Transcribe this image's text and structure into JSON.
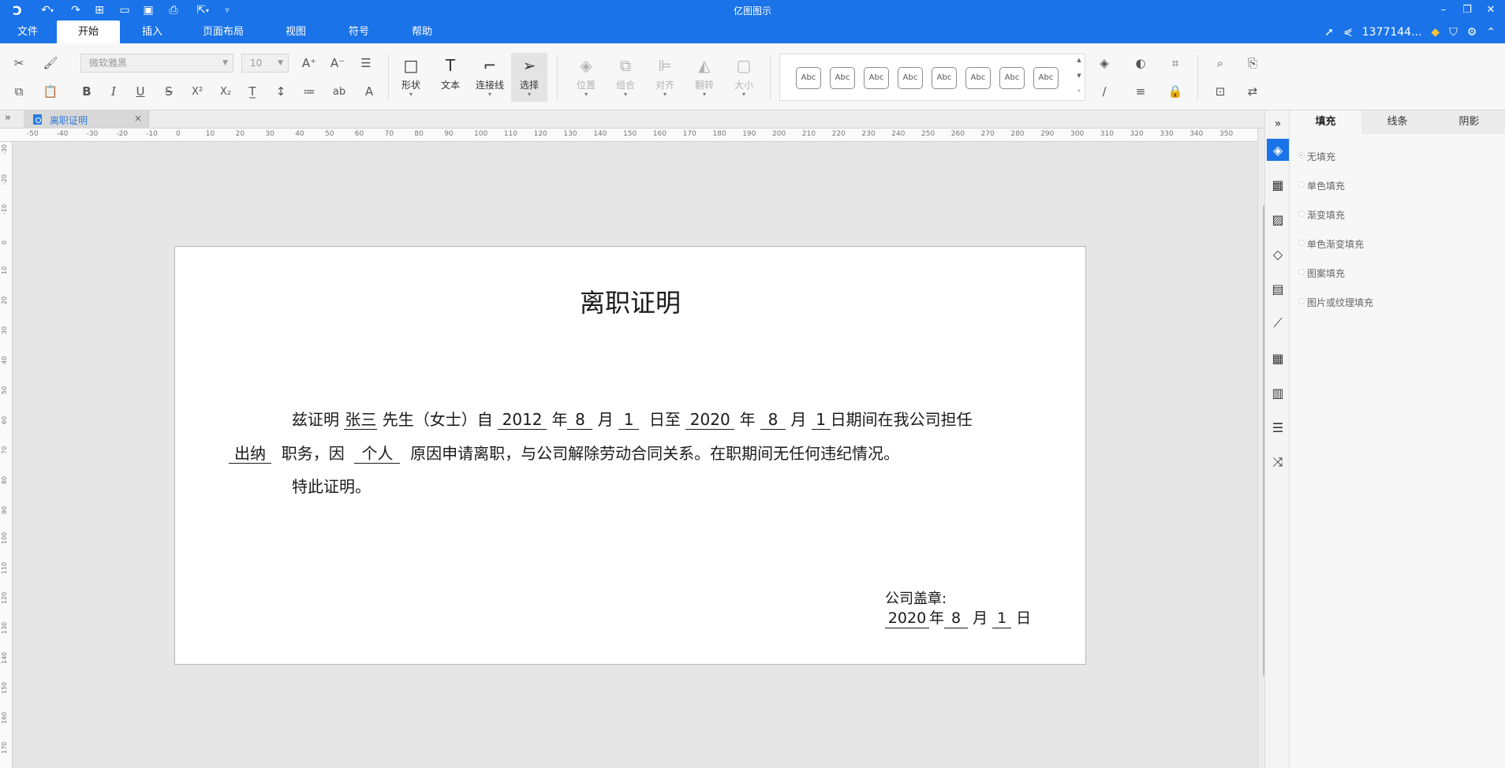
{
  "app": {
    "title": "亿图图示",
    "user": "1377144...",
    "colors": {
      "brand": "#1a73e8",
      "panel": "#f7f7f7",
      "canvas": "#e6e6e6"
    }
  },
  "titlebar_icons": [
    "logo-icon",
    "undo-icon",
    "redo-icon",
    "new-icon",
    "open-icon",
    "save-icon",
    "print-icon",
    "export-icon",
    "more-icon"
  ],
  "menu": {
    "tabs": [
      "文件",
      "开始",
      "插入",
      "页面布局",
      "视图",
      "符号",
      "帮助"
    ],
    "active": "开始"
  },
  "toolbar": {
    "font_family": "微软雅黑",
    "font_size": "10",
    "tools": [
      "形状",
      "文本",
      "连接线",
      "选择",
      "位置",
      "组合",
      "对齐",
      "翻转",
      "大小"
    ],
    "style_swatch_label": "Abc"
  },
  "document_tab": {
    "name": "离职证明",
    "close": "×"
  },
  "ruler": {
    "top_labels": [
      "-50",
      "-40",
      "-30",
      "-20",
      "-10",
      "0",
      "10",
      "20",
      "30",
      "40",
      "50",
      "60",
      "70",
      "80",
      "90",
      "100",
      "110",
      "120",
      "130",
      "140",
      "150",
      "160",
      "170",
      "180",
      "190",
      "200",
      "210",
      "220",
      "230",
      "240",
      "250",
      "260",
      "270",
      "280",
      "290",
      "300",
      "310",
      "320",
      "330",
      "340",
      "350"
    ],
    "left_labels": [
      "-30",
      "-20",
      "-10",
      "0",
      "10",
      "20",
      "30",
      "40",
      "50",
      "60",
      "70",
      "80",
      "90",
      "100",
      "110",
      "120",
      "130",
      "140",
      "150",
      "160",
      "170"
    ]
  },
  "document": {
    "title": "离职证明",
    "line1": {
      "prefix": "兹证明",
      "name": "张三",
      "gender": "先生（女士）自",
      "start_year": "2012",
      "t_year": "年",
      "start_month": "8",
      "t_month": "月",
      "start_day": "1",
      "t_to": "日至",
      "end_year": "2020",
      "t_year2": "年",
      "end_month": "8",
      "t_month2": "月",
      "end_day": "1",
      "suffix": "日期间在我公司担任"
    },
    "line2": {
      "position": "出纳",
      "t_duty": "职务，因",
      "reason": "个人",
      "suffix": "原因申请离职，与公司解除劳动合同关系。在职期间无任何违纪情况。"
    },
    "line3": "特此证明。",
    "stamp_label": "公司盖章:",
    "stamp_date": {
      "year": "2020",
      "t_year": "年",
      "month": "8",
      "t_month": "月",
      "day": "1",
      "t_day": "日"
    }
  },
  "side_icons": [
    "fill-icon",
    "grid-icon",
    "image-icon",
    "layers-icon",
    "page-icon",
    "chart-icon",
    "table-icon",
    "layout-icon",
    "text-style-icon",
    "shuffle-icon"
  ],
  "panel": {
    "tabs": [
      "填充",
      "线条",
      "阴影"
    ],
    "active_tab": "填充",
    "fill_options": [
      "无填充",
      "单色填充",
      "渐变填充",
      "单色渐变填充",
      "图案填充",
      "图片或纹理填充"
    ],
    "selected_option": "无填充"
  }
}
